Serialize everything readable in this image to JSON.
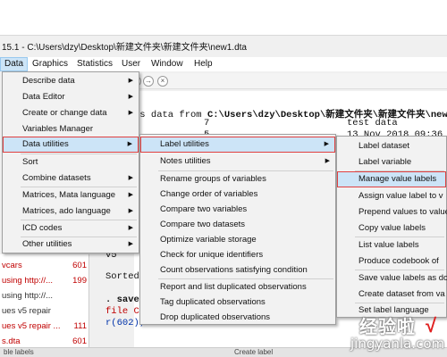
{
  "window": {
    "title": "15.1 - C:\\Users\\dzy\\Desktop\\新建文件夹\\新建文件夹\\new1.dta"
  },
  "menubar": [
    "Data",
    "Graphics",
    "Statistics",
    "User",
    "Window",
    "Help"
  ],
  "data_menu": [
    {
      "label": "Describe data",
      "arrow": "▶"
    },
    {
      "label": "Data Editor",
      "arrow": "▶"
    },
    {
      "label": "Create or change data",
      "arrow": "▶"
    },
    {
      "label": "Variables Manager",
      "arrow": ""
    },
    {
      "label": "Data utilities",
      "arrow": "▶"
    },
    {
      "label": "Sort",
      "arrow": ""
    },
    {
      "label": "Combine datasets",
      "arrow": "▶"
    },
    {
      "label": "Matrices, Mata language",
      "arrow": "▶"
    },
    {
      "label": "Matrices, ado language",
      "arrow": "▶"
    },
    {
      "label": "ICD codes",
      "arrow": "▶"
    },
    {
      "label": "Other utilities",
      "arrow": "▶"
    }
  ],
  "utilities_menu": [
    {
      "label": "Label utilities",
      "arrow": "▶"
    },
    {
      "label": "Notes utilities",
      "arrow": "▶"
    },
    {
      "label": "Rename groups of variables",
      "arrow": ""
    },
    {
      "label": "Change order of variables",
      "arrow": ""
    },
    {
      "label": "Compare two variables",
      "arrow": ""
    },
    {
      "label": "Compare two datasets",
      "arrow": ""
    },
    {
      "label": "Optimize variable storage",
      "arrow": ""
    },
    {
      "label": "Check for unique identifiers",
      "arrow": ""
    },
    {
      "label": "Count observations satisfying condition",
      "arrow": ""
    },
    {
      "label": "Report and list duplicated observations",
      "arrow": ""
    },
    {
      "label": "Tag duplicated observations",
      "arrow": ""
    },
    {
      "label": "Drop duplicated observations",
      "arrow": ""
    }
  ],
  "label_menu": [
    {
      "label": "Label dataset"
    },
    {
      "label": "Label variable"
    },
    {
      "label": "Manage value labels"
    },
    {
      "label": "Assign value label to v"
    },
    {
      "label": "Prepend values to value"
    },
    {
      "label": "Copy value labels"
    },
    {
      "label": "List value labels"
    },
    {
      "label": "Produce codebook of"
    },
    {
      "label": "Save value labels as do"
    },
    {
      "label": "Create dataset from va"
    },
    {
      "label": "Set label language"
    }
  ],
  "results": {
    "line1_prefix": "ns data from",
    "line1_path": "C:\\Users\\dzy\\Desktop\\新建文件夹\\新建文件夹\\new",
    "line2_num": "7",
    "line2_label": "test data",
    "line3_num": "5",
    "line3_date": "13 Nov 2018 09:36",
    "v5": "v5",
    "sorted": "Sorted",
    "save": ". save",
    "file": "file C",
    "r": "r(602);"
  },
  "left_pane": [
    {
      "text": "vcars",
      "num": "601",
      "color": "red"
    },
    {
      "text": " using http://...",
      "num": "199",
      "color": "red"
    },
    {
      "text": " using http://...",
      "num": "",
      "color": "dark"
    },
    {
      "text": "ues v5 repair",
      "num": "",
      "color": "dark"
    },
    {
      "text": "ues v5 repair ...",
      "num": "111",
      "color": "red"
    },
    {
      "text": "s.dta",
      "num": "601",
      "color": "red"
    }
  ],
  "status": {
    "left": "ble labels",
    "mid": "Create label"
  },
  "watermark": {
    "line1": "经验啦",
    "line2": "jingyanla.com",
    "check": "√"
  }
}
